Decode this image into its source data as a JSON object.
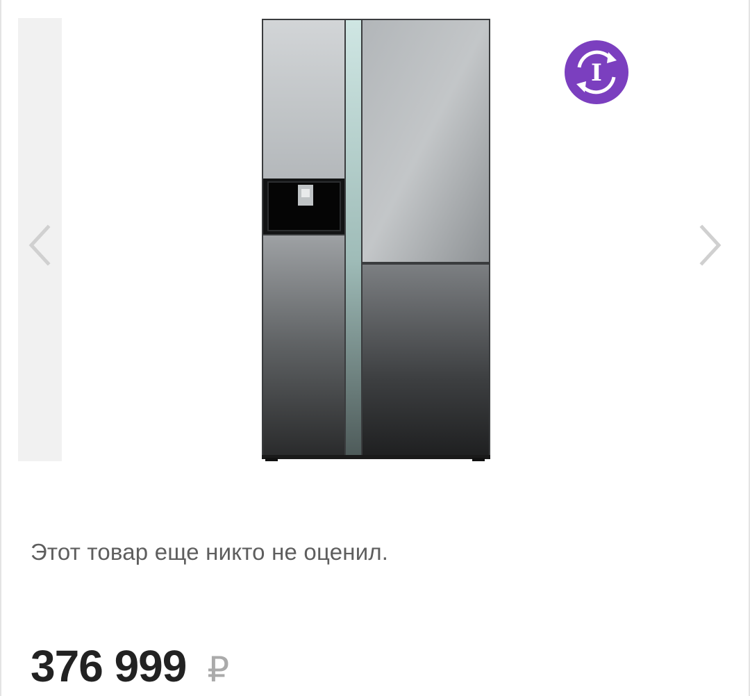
{
  "product": {
    "image_alt": "refrigerator",
    "rating_text": "Этот товар еще никто не оценил.",
    "price": {
      "value": "376 999",
      "currency": "₽"
    }
  },
  "gallery": {
    "prev_icon": "chevron-left-icon",
    "next_icon": "chevron-right-icon",
    "badge_icon": "info-refresh-icon",
    "badge_letter": "I"
  },
  "colors": {
    "badge": "#7b3fbf",
    "arrow": "#d0d0d0",
    "price_text": "#222222",
    "currency": "#aaaaaa",
    "rating_text": "#5e5e5e"
  }
}
